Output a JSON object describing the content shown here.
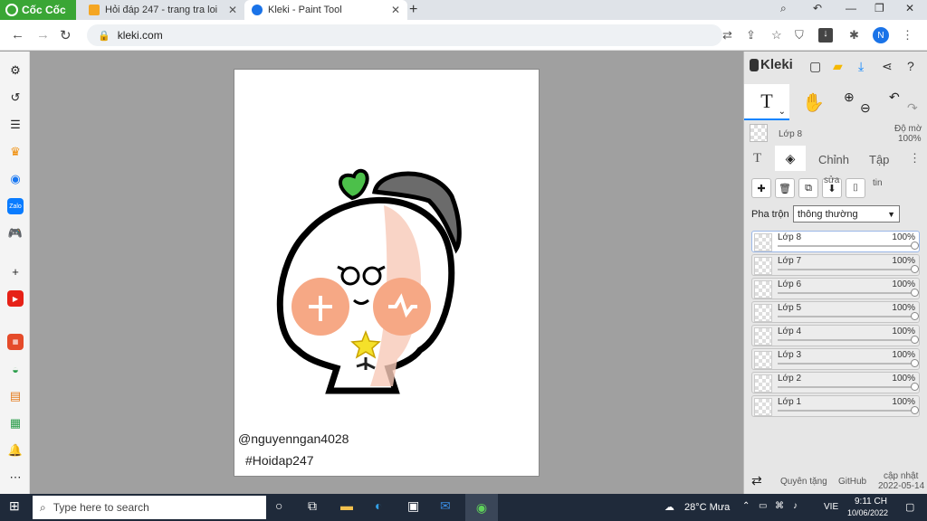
{
  "browser": {
    "brand": "Cốc Cốc",
    "tabs": [
      {
        "title": "Hỏi đáp 247 - trang tra loi",
        "color": "#f5a623"
      },
      {
        "title": "Kleki - Paint Tool",
        "color": "#1a73e8"
      }
    ],
    "url": "kleki.com",
    "profile_initial": "N"
  },
  "canvas": {
    "signature": "@nguyenngan4028",
    "hashtag": "#Hoidap247"
  },
  "kleki": {
    "logo": "Kleki",
    "current_tool": "T",
    "current_layer_label": "Lớp 8",
    "opacity_label": "Độ mờ",
    "opacity_value": "100%",
    "tab_edit": "Chỉnh",
    "tab_file": "Tập",
    "edit_suffix": "sửa",
    "file_suffix": "tin",
    "blend_label": "Pha trộn",
    "blend_value": "thông thường",
    "layers": [
      {
        "name": "Lớp 8",
        "opacity": "100%"
      },
      {
        "name": "Lớp 7",
        "opacity": "100%"
      },
      {
        "name": "Lớp 6",
        "opacity": "100%"
      },
      {
        "name": "Lớp 5",
        "opacity": "100%"
      },
      {
        "name": "Lớp 4",
        "opacity": "100%"
      },
      {
        "name": "Lớp 3",
        "opacity": "100%"
      },
      {
        "name": "Lớp 2",
        "opacity": "100%"
      },
      {
        "name": "Lớp 1",
        "opacity": "100%"
      }
    ],
    "footer": {
      "donate": "Quyên tặng",
      "github": "GitHub",
      "updated_label": "cập nhật",
      "updated_date": "2022-05-14"
    }
  },
  "taskbar": {
    "search_placeholder": "Type here to search",
    "weather": "28°C  Mưa",
    "lang": "VIE",
    "time": "9:11 CH",
    "date": "10/06/2022"
  }
}
